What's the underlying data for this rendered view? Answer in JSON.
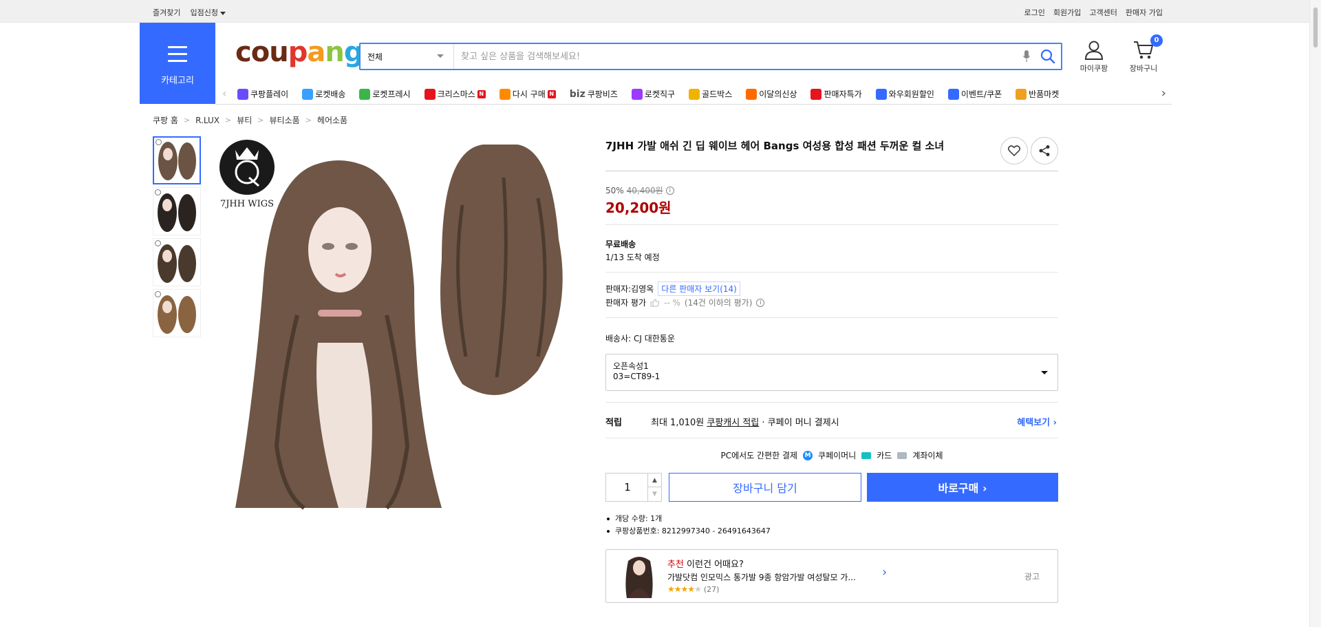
{
  "topbar": {
    "left": [
      "즐겨찾기",
      "입점신청"
    ],
    "right": [
      "로그인",
      "회원가입",
      "고객센터",
      "판매자 가입"
    ]
  },
  "header": {
    "category_label": "카테고리",
    "logo_text": "coupang",
    "search_scope": "전체",
    "search_placeholder": "찾고 싶은 상품을 검색해보세요!",
    "my_coupang": "마이쿠팡",
    "cart_label": "장바구니",
    "cart_count": "0"
  },
  "nav": {
    "items": [
      {
        "label": "쿠팡플레이",
        "icon": "play-icon",
        "color": "#6c4bff"
      },
      {
        "label": "로켓배송",
        "icon": "rocket-icon",
        "color": "#3aa0ff"
      },
      {
        "label": "로켓프레시",
        "icon": "rocket-fresh-icon",
        "color": "#3bb54a"
      },
      {
        "label": "크리스마스",
        "icon": "santa-icon",
        "color": "#e5141d"
      },
      {
        "label": "다시 구매",
        "icon": "home-icon",
        "color": "#ff8a00"
      },
      {
        "label": "쿠팡비즈",
        "icon": "biz-icon",
        "color": "#555555"
      },
      {
        "label": "로켓직구",
        "icon": "globe-icon",
        "color": "#9b3bff"
      },
      {
        "label": "골드박스",
        "icon": "gift-icon",
        "color": "#f0b400"
      },
      {
        "label": "이달의신상",
        "icon": "new-icon",
        "color": "#ff6a00"
      },
      {
        "label": "판매자특가",
        "icon": "percent-icon",
        "color": "#e5141d"
      },
      {
        "label": "와우회원할인",
        "icon": "wow-icon",
        "color": "#346aff"
      },
      {
        "label": "이벤트/쿠폰",
        "icon": "coupon-icon",
        "color": "#346aff"
      },
      {
        "label": "반품마켓",
        "icon": "market-icon",
        "color": "#f0a020"
      }
    ],
    "new_badge": "N",
    "biz_prefix": "biz"
  },
  "breadcrumb": [
    "쿠팡 홈",
    "R.LUX",
    "뷰티",
    "뷰티소품",
    "헤어소품"
  ],
  "product": {
    "brand_logo_text": "7JHH WIGS",
    "title": "7JHH 가발 애쉬 긴 딥 웨이브 헤어 Bangs 여성용 합성 패션 두꺼운 컬 소녀",
    "discount_rate": "50%",
    "original_price": "40,400원",
    "price": "20,200원",
    "shipping_title": "무료배송",
    "shipping_eta": "1/13 도착 예정",
    "seller_label": "판매자:김영옥",
    "seller_link": "다른 판매자 보기(14)",
    "seller_rating_label": "판매자 평가",
    "seller_rating_value": "-- %",
    "seller_rating_note": "(14건 이하의 평가)",
    "carrier": "배송사:  CJ 대한통운",
    "option_name": "오픈속성1",
    "option_value": "03=CT89-1",
    "reward_label": "적립",
    "reward_text_1": "최대 1,010원 ",
    "reward_link": "쿠팡캐시 적립",
    "reward_text_2": " · 쿠페이 머니 결제시",
    "reward_more": "혜택보기",
    "pay_label": "PC에서도 간편한 결제",
    "pay_methods": [
      "쿠페이머니",
      "카드",
      "계좌이체"
    ],
    "quantity": "1",
    "cart_button": "장바구니 담기",
    "buy_button": "바로구매",
    "facts": [
      "개당 수량: 1개",
      "쿠팡상품번호: 8212997340 - 26491643647"
    ]
  },
  "recommend": {
    "tag": "추천",
    "head": " 이런건 어때요?",
    "desc": "가발닷컴 인모믹스 통가발 9종 항암가발 여성탈모 가...",
    "rating": 4,
    "review_count": "(27)",
    "ad_label": "광고"
  }
}
